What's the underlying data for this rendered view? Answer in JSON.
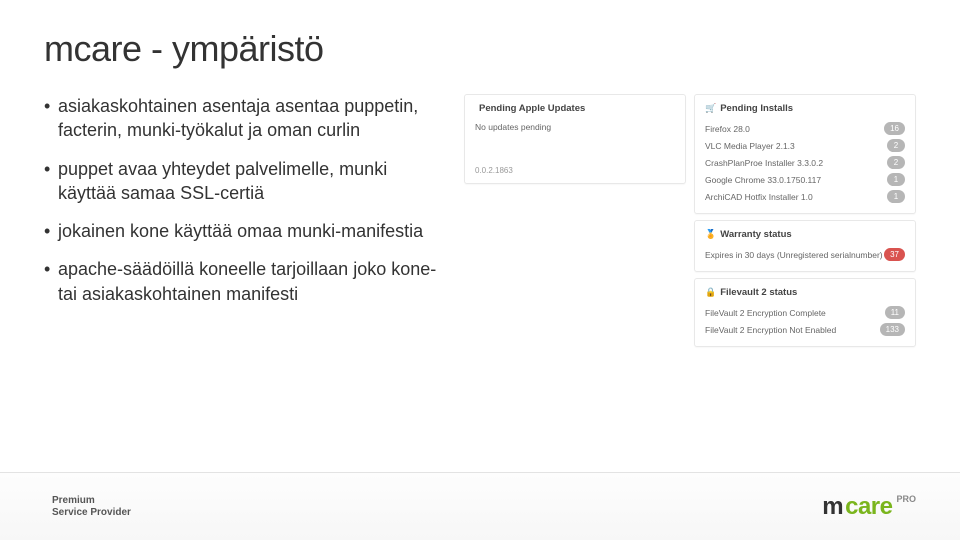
{
  "title": "mcare - ympäristö",
  "bullets": [
    "asiakaskohtainen asentaja asentaa puppetin, facterin, munki-työkalut ja oman curlin",
    "puppet avaa yhteydet palvelimelle, munki käyttää samaa SSL-certiä",
    "jokainen kone käyttää omaa munki-manifestia",
    "apache-säädöillä koneelle tarjoillaan joko kone- tai asiakaskohtainen manifesti"
  ],
  "leftPanel": {
    "head": "Pending Apple Updates",
    "none": "No updates pending",
    "stub": "0.0.2.1863"
  },
  "installs": {
    "head": "Pending Installs",
    "rows": [
      {
        "name": "Firefox 28.0",
        "count": "16"
      },
      {
        "name": "VLC Media Player 2.1.3",
        "count": "2"
      },
      {
        "name": "CrashPlanProe Installer 3.3.0.2",
        "count": "2"
      },
      {
        "name": "Google Chrome 33.0.1750.117",
        "count": "1"
      },
      {
        "name": "ArchiCAD Hotfix Installer 1.0",
        "count": "1"
      }
    ]
  },
  "warranty": {
    "head": "Warranty status",
    "text": "Expires in 30 days (Unregistered serialnumber)",
    "count": "37"
  },
  "filevault": {
    "head": "Filevault 2 status",
    "rows": [
      {
        "name": "FileVault 2 Encryption Complete",
        "count": "11"
      },
      {
        "name": "FileVault 2 Encryption Not Enabled",
        "count": "133"
      }
    ]
  },
  "footer": {
    "line1": "Premium",
    "line2": "Service Provider",
    "brand_m": "m",
    "brand_care": "care",
    "brand_pro": "PRO"
  }
}
